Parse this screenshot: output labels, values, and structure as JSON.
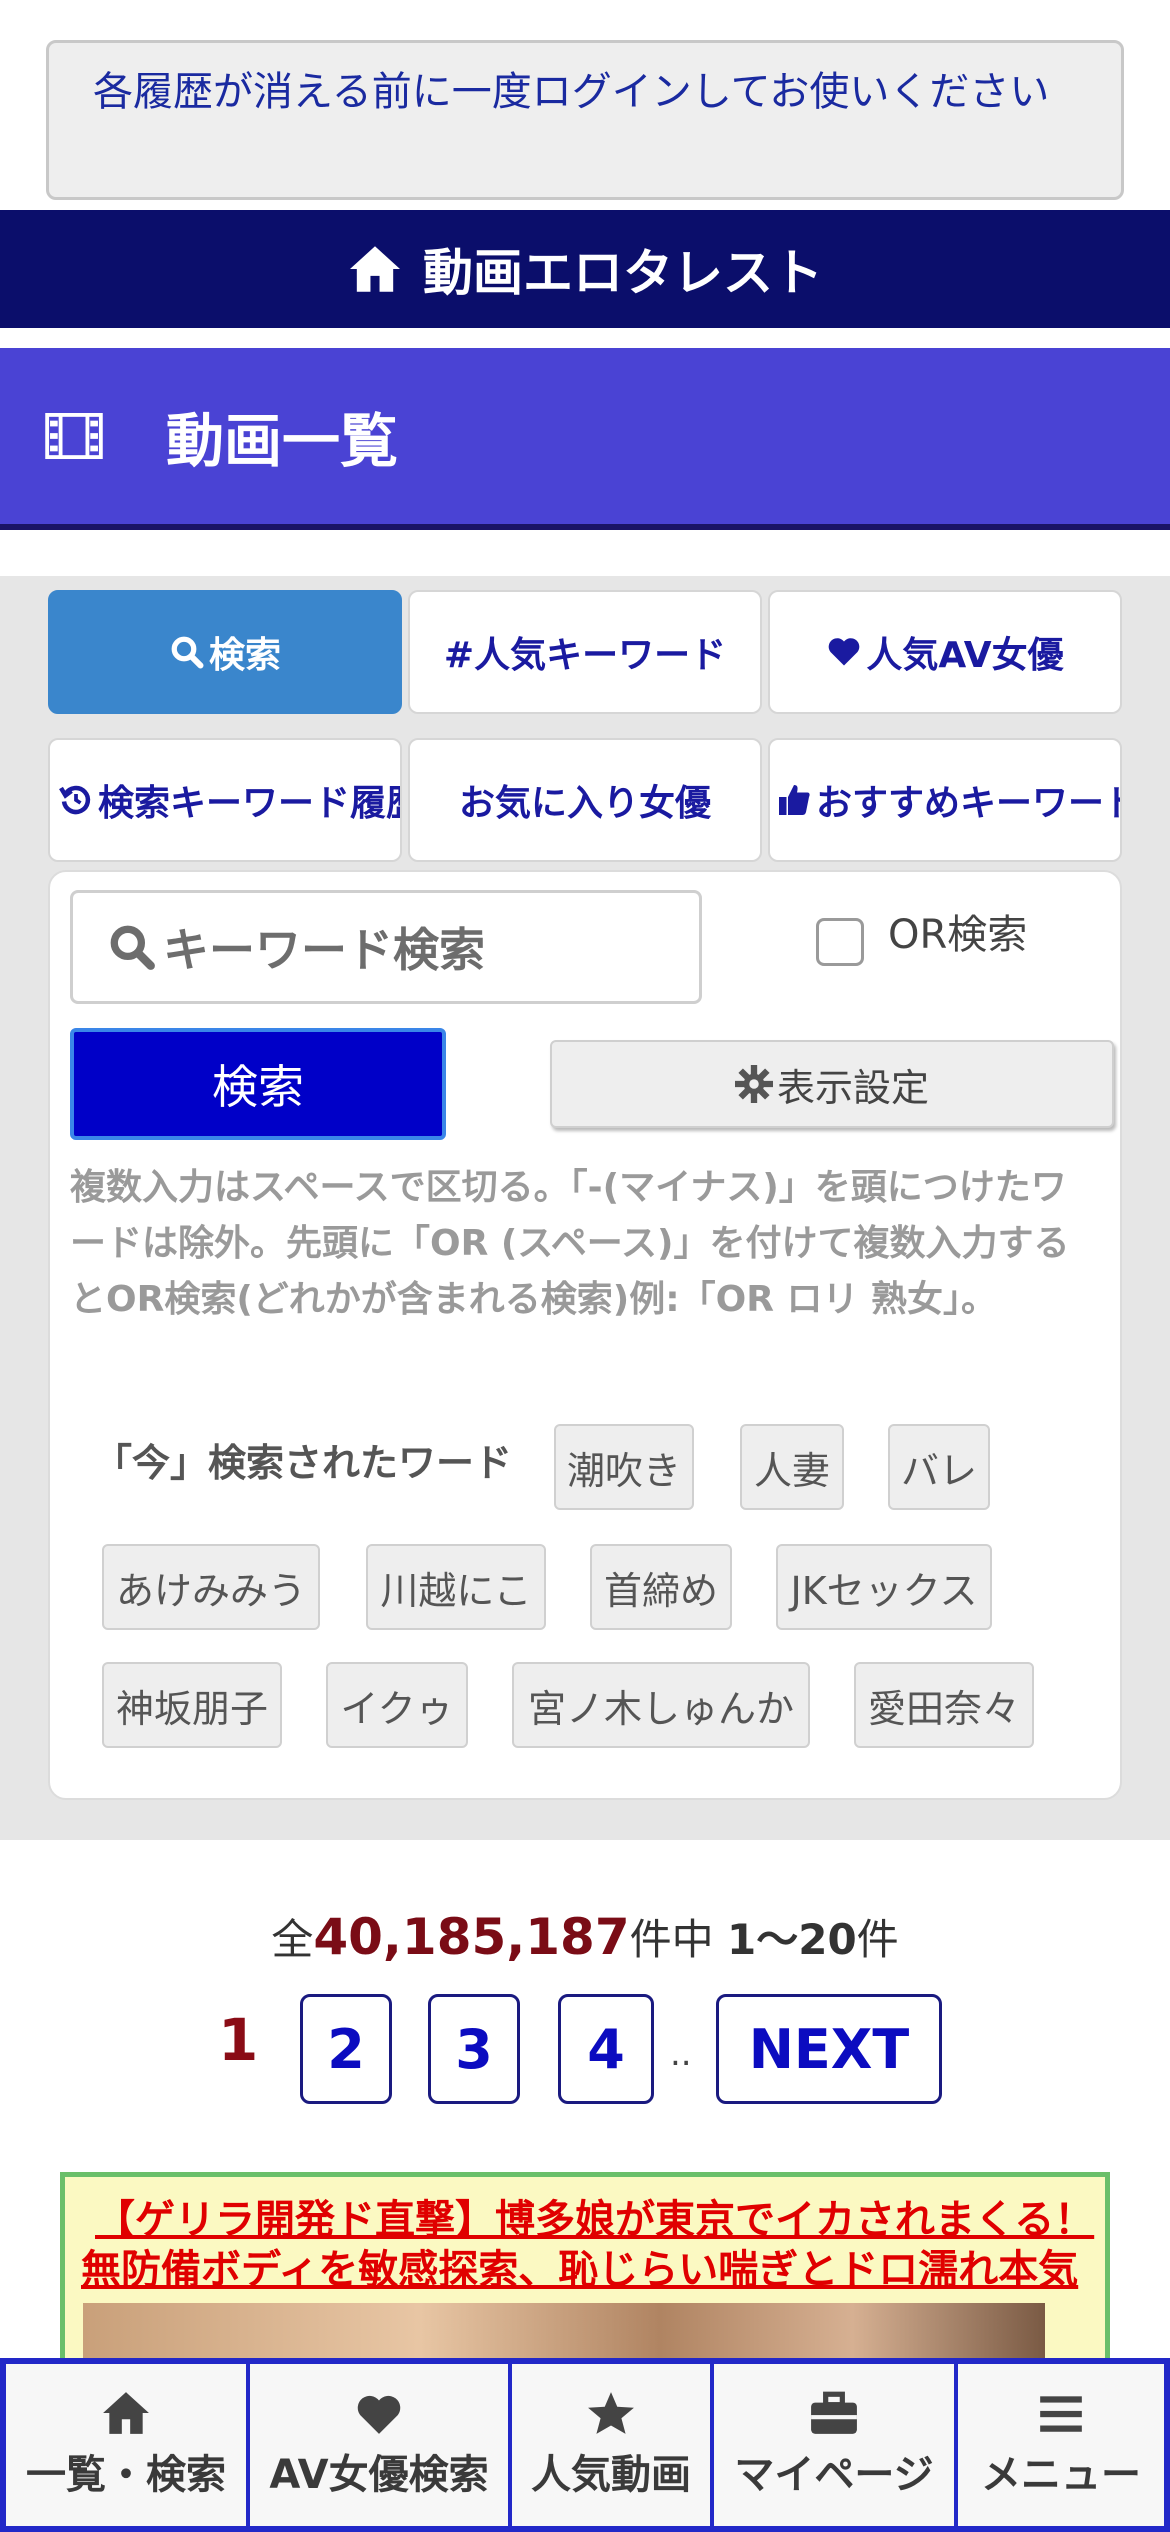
{
  "notice": "各履歴が消える前に一度ログインしてお使いください",
  "site": {
    "title": "動画エロタレスト"
  },
  "list_heading": "動画一覧",
  "tabs": [
    {
      "label": "検索",
      "icon": "search-icon",
      "active": true
    },
    {
      "label": "#人気キーワード",
      "icon": "",
      "active": false
    },
    {
      "label": "人気AV女優",
      "icon": "heart-icon",
      "active": false
    },
    {
      "label": "検索キーワード履歴",
      "icon": "history-icon",
      "active": false
    },
    {
      "label": "お気に入り女優",
      "icon": "",
      "active": false
    },
    {
      "label": "おすすめキーワード",
      "icon": "thumbs-up-icon",
      "active": false
    }
  ],
  "search": {
    "placeholder": "キーワード検索",
    "or_label": "OR検索",
    "button": "検索",
    "settings_button": "表示設定",
    "help": "複数入力はスペースで区切る。「-(マイナス)」を頭につけたワードは除外。先頭に「OR (スペース)」を付けて複数入力するとOR検索(どれかが含まれる検索)例:「OR ロリ 熟女」。"
  },
  "trending": {
    "label": "「今」検索されたワード",
    "words": [
      "潮吹き",
      "人妻",
      "バレ",
      "あけみみう",
      "川越にこ",
      "首締め",
      "JKセックス",
      "神坂朋子",
      "イクゥ",
      "宮ノ木しゅんか",
      "愛田奈々"
    ]
  },
  "results": {
    "prefix": "全",
    "total": "40,185,187",
    "mid": "件中 ",
    "range": "1〜20",
    "suffix": "件"
  },
  "pagination": {
    "current": "1",
    "pages": [
      "2",
      "3",
      "4"
    ],
    "ellipsis": "..",
    "next": "NEXT"
  },
  "ad": {
    "line1": "【ゲリラ開発ド直撃】博多娘が東京でイカされまくる！",
    "line2": "無防備ボディを敏感探索、恥じらい喘ぎとドロ濡れ本気"
  },
  "bottom_nav": [
    {
      "label": "一覧・検索",
      "icon": "home-icon"
    },
    {
      "label": "AV女優検索",
      "icon": "heart-icon"
    },
    {
      "label": "人気動画",
      "icon": "star-icon"
    },
    {
      "label": "マイページ",
      "icon": "briefcase-icon"
    },
    {
      "label": "メニュー",
      "icon": "menu-icon"
    }
  ],
  "colors": {
    "header": "#0b0e6b",
    "list_header": "#4a43d4",
    "active_tab": "#3a86cc",
    "search_button": "#0000c8",
    "count": "#7a0c16",
    "nav": "#2228c8"
  }
}
